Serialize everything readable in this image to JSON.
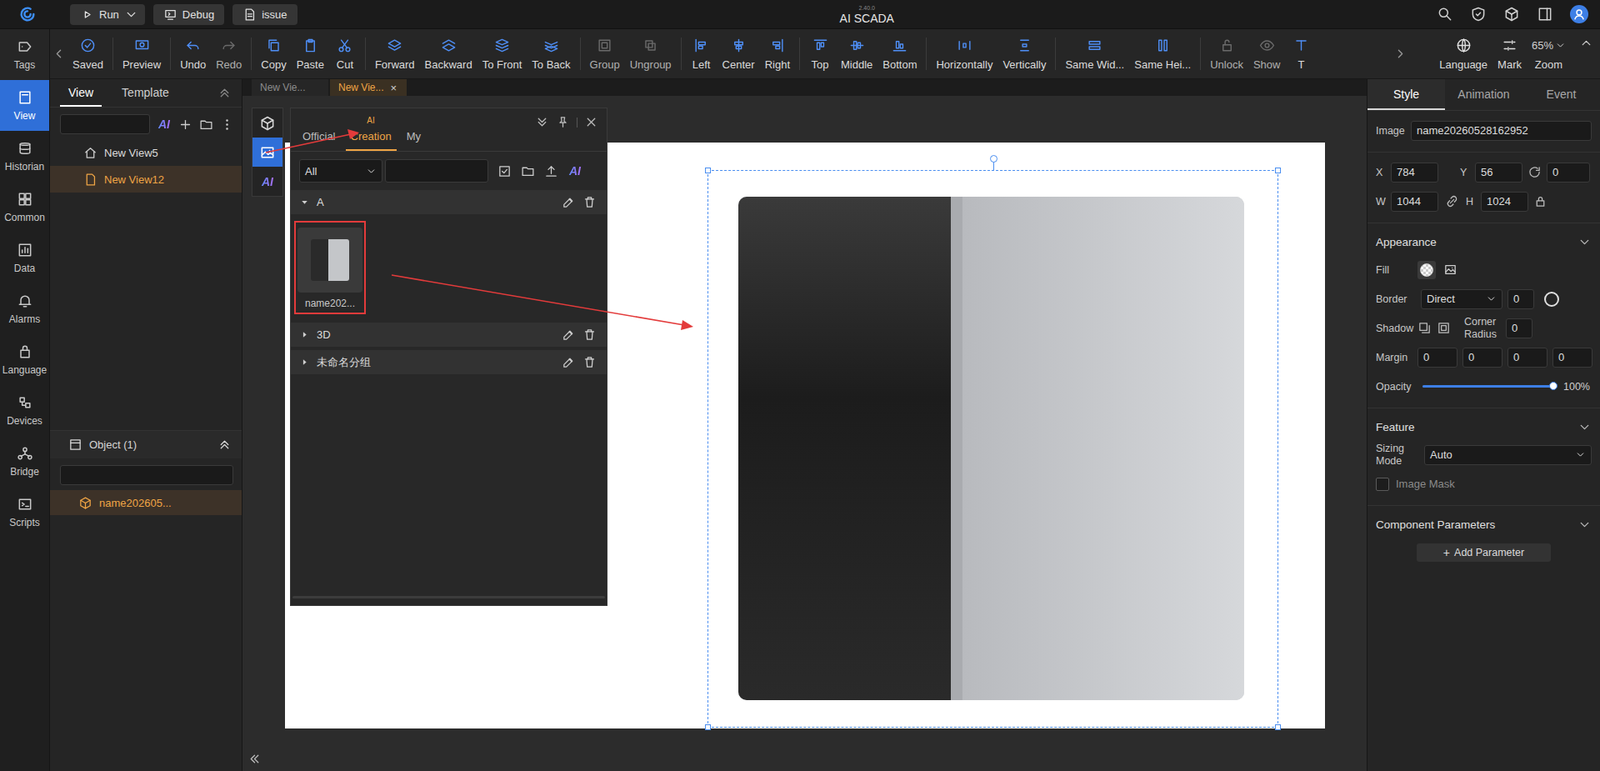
{
  "app": {
    "title": "AI SCADA",
    "version": "2.40.0"
  },
  "top_bar": {
    "run": {
      "label": "Run"
    },
    "debug": {
      "label": "Debug"
    },
    "issue": {
      "label": "issue"
    }
  },
  "nav_rail": [
    {
      "label": "Tags",
      "selected": false
    },
    {
      "label": "View",
      "selected": true
    },
    {
      "label": "Historian",
      "selected": false
    },
    {
      "label": "Common",
      "selected": false
    },
    {
      "label": "Data",
      "selected": false
    },
    {
      "label": "Alarms",
      "selected": false
    },
    {
      "label": "Language",
      "selected": false
    },
    {
      "label": "Devices",
      "selected": false
    },
    {
      "label": "Bridge",
      "selected": false
    },
    {
      "label": "Scripts",
      "selected": false
    }
  ],
  "toolbar": {
    "groups": [
      [
        {
          "label": "Saved",
          "disabled": false
        }
      ],
      [
        {
          "label": "Preview",
          "disabled": false
        }
      ],
      [
        {
          "label": "Undo",
          "disabled": false
        },
        {
          "label": "Redo",
          "disabled": true
        }
      ],
      [
        {
          "label": "Copy",
          "disabled": false
        },
        {
          "label": "Paste",
          "disabled": false
        },
        {
          "label": "Cut",
          "disabled": false
        }
      ],
      [
        {
          "label": "Forward",
          "disabled": false
        },
        {
          "label": "Backward",
          "disabled": false
        },
        {
          "label": "To Front",
          "disabled": false
        },
        {
          "label": "To Back",
          "disabled": false
        }
      ],
      [
        {
          "label": "Group",
          "disabled": true
        },
        {
          "label": "Ungroup",
          "disabled": true
        }
      ],
      [
        {
          "label": "Left",
          "disabled": false
        },
        {
          "label": "Center",
          "disabled": false
        },
        {
          "label": "Right",
          "disabled": false
        }
      ],
      [
        {
          "label": "Top",
          "disabled": false
        },
        {
          "label": "Middle",
          "disabled": false
        },
        {
          "label": "Bottom",
          "disabled": false
        }
      ],
      [
        {
          "label": "Horizontally",
          "disabled": false
        },
        {
          "label": "Vertically",
          "disabled": false
        }
      ],
      [
        {
          "label": "Same Wid...",
          "disabled": false
        },
        {
          "label": "Same Hei...",
          "disabled": false
        }
      ],
      [
        {
          "label": "Unlock",
          "disabled": true
        },
        {
          "label": "Show",
          "disabled": true
        },
        {
          "label": "T",
          "disabled": false
        }
      ]
    ],
    "right_items": [
      {
        "label": "Language"
      },
      {
        "label": "Mark"
      }
    ],
    "zoom": {
      "label": "Zoom",
      "value": "65%"
    }
  },
  "left_panel": {
    "tabs": [
      {
        "label": "View",
        "selected": true
      },
      {
        "label": "Template",
        "selected": false
      }
    ],
    "ai_label": "AI",
    "views": [
      {
        "label": "New View5",
        "kind": "home",
        "selected": false
      },
      {
        "label": "New View12",
        "kind": "page",
        "selected": true
      }
    ],
    "objects": {
      "title": "Object (1)",
      "items": [
        {
          "label": "name202605...",
          "selected": true
        }
      ]
    }
  },
  "document_tabs": [
    {
      "label": "New Vie...",
      "selected": false,
      "close": ""
    },
    {
      "label": "New Vie...",
      "selected": true,
      "close": "×"
    }
  ],
  "side_strip": {
    "items": [
      {
        "kind": "component",
        "selected": false,
        "label": ""
      },
      {
        "kind": "image",
        "selected": true,
        "label": ""
      },
      {
        "kind": "ai",
        "selected": false,
        "label": "AI"
      }
    ]
  },
  "library_panel": {
    "tabs": [
      {
        "label": "Official",
        "selected": false,
        "badge": ""
      },
      {
        "label": "Creation",
        "selected": true,
        "badge": "AI"
      },
      {
        "label": "My",
        "selected": false,
        "badge": ""
      }
    ],
    "filter": "All",
    "search": "",
    "ai_label": "AI",
    "groups": [
      {
        "name": "A",
        "expanded": true,
        "items": [
          {
            "label": "name202...",
            "highlighted": true
          }
        ]
      },
      {
        "name": "3D",
        "expanded": false,
        "items": []
      },
      {
        "name": "未命名分组",
        "expanded": false,
        "items": []
      }
    ]
  },
  "canvas": {
    "image_selected": true
  },
  "properties": {
    "tabs": [
      {
        "label": "Style",
        "selected": true
      },
      {
        "label": "Animation",
        "selected": false
      },
      {
        "label": "Event",
        "selected": false
      }
    ],
    "image": {
      "label": "Image",
      "value": "name20260528162952"
    },
    "position": {
      "x_label": "X",
      "x": "784",
      "y_label": "Y",
      "y": "56",
      "rotation": "0"
    },
    "size": {
      "w_label": "W",
      "w": "1044",
      "h_label": "H",
      "h": "1024"
    },
    "appearance": {
      "title": "Appearance",
      "expanded": true,
      "fill": {
        "label": "Fill",
        "modes": [
          {
            "kind": "color",
            "selected": true
          },
          {
            "kind": "image",
            "selected": false
          }
        ]
      },
      "border": {
        "label": "Border",
        "style": "Direct",
        "width": "0"
      },
      "shadow": {
        "label": "Shadow",
        "options": [
          {
            "kind": "outer",
            "selected": false
          },
          {
            "kind": "inner",
            "selected": false
          }
        ]
      },
      "corner_radius": {
        "label": "Corner Radius",
        "value": "0"
      },
      "margin": {
        "label": "Margin",
        "values": [
          "0",
          "0",
          "0",
          "0"
        ]
      },
      "opacity": {
        "label": "Opacity",
        "level": 1,
        "reading": "100%"
      }
    },
    "feature": {
      "title": "Feature",
      "expanded": true,
      "sizing": {
        "label": "Sizing Mode",
        "value": "Auto"
      },
      "image_mask": {
        "label": "Image Mask",
        "checked": false,
        "disabled": true
      }
    },
    "parameters": {
      "title": "Component Parameters",
      "expanded": true,
      "button": {
        "icon": "+",
        "label": "Add Parameter"
      }
    }
  }
}
